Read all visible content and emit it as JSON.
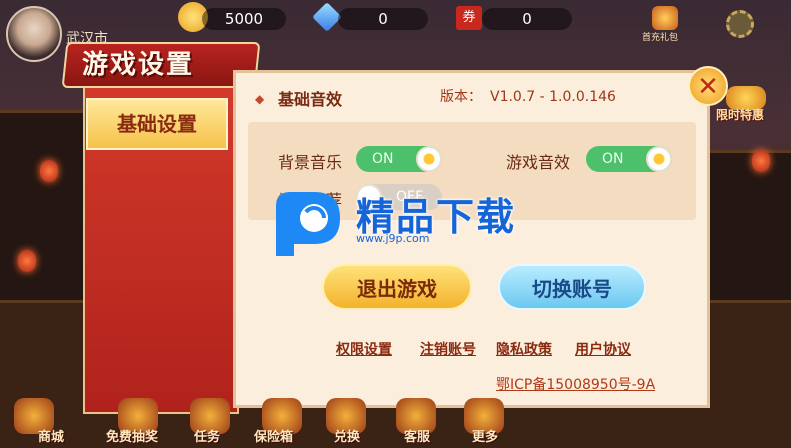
{
  "top_bar": {
    "coins": "5000",
    "diamonds": "0",
    "tickets": "0",
    "first_recharge_label": "首充礼包",
    "city": "武汉市",
    "ticket_tag": "券"
  },
  "dialog": {
    "title": "游戏设置",
    "side_tab": "基础设置",
    "section_title": "基础音效",
    "version_label": "版本：",
    "version_value": "V1.0.7 - 1.0.0.146",
    "settings": [
      {
        "label": "背景音乐",
        "state": "ON"
      },
      {
        "label": "游戏音效",
        "state": "ON"
      },
      {
        "label": "福利推荐",
        "state": "OFF"
      }
    ],
    "exit_button": "退出游戏",
    "switch_button": "切换账号",
    "links": [
      "权限设置",
      "注销账号",
      "隐私政策",
      "用户协议"
    ],
    "icp": "鄂ICP备15008950号-9A",
    "close_symbol": "✕"
  },
  "side_event": "限时特惠",
  "watermark": {
    "text": "精品下载",
    "url": "www.j9p.com"
  },
  "dock": {
    "items": [
      "商城",
      "免费抽奖",
      "任务",
      "保险箱",
      "兑换",
      "客服",
      "更多"
    ]
  },
  "colors": {
    "panel_bg": "#fbeedd",
    "accent_red": "#b8231f",
    "toggle_on": "#4cc06a",
    "exit_btn": "#f3b22c",
    "switch_btn": "#6cc8f0"
  }
}
